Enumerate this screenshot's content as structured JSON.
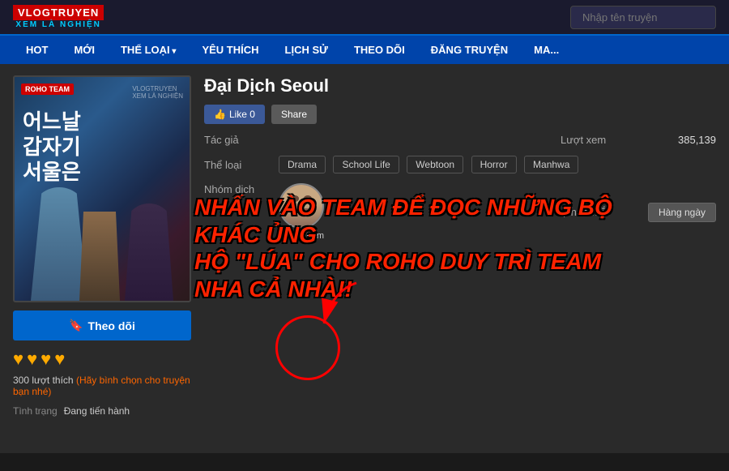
{
  "header": {
    "logo_top": "VLOGTRUYEN",
    "logo_bottom": "XEM LÀ NGHIỆN",
    "search_placeholder": "Nhập tên truyện"
  },
  "nav": {
    "items": [
      {
        "label": "HOT",
        "id": "hot"
      },
      {
        "label": "MỚI",
        "id": "moi"
      },
      {
        "label": "THỂ LOẠI",
        "id": "the-loai",
        "has_arrow": true
      },
      {
        "label": "YÊU THÍCH",
        "id": "yeu-thich"
      },
      {
        "label": "LỊCH SỬ",
        "id": "lich-su"
      },
      {
        "label": "THEO DÕI",
        "id": "theo-doi"
      },
      {
        "label": "ĐĂNG TRUYỆN",
        "id": "dang-truyen"
      },
      {
        "label": "MA...",
        "id": "ma"
      }
    ]
  },
  "manga": {
    "title": "Đại Dịch Seoul",
    "cover_title_korean": "어느날\n갑자기\n서울은",
    "cover_roho_team": "ROHO\nTEAM",
    "like_count": "Like 0",
    "share_label": "Share",
    "tac_gia_label": "Tác giả",
    "tac_gia_value": "",
    "luot_xem_label": "Lượt xem",
    "luot_xem_value": "385,139",
    "the_loai_label": "Thể loại",
    "tags": [
      "Drama",
      "School Life",
      "Webtoon",
      "Horror",
      "Manhwa"
    ],
    "nhom_dich_label": "Nhóm dịch",
    "nhom_dich_team": "Roho Team",
    "lich_ra_mat_label": "Lịch ra mắt",
    "lich_ra_mat_value": "Hàng ngày",
    "theo_doi_label": "Theo dõi",
    "likes_300": "300 lượt thích",
    "vote_text": "(Hãy bình chọn cho truyện bạn nhé)",
    "tinh_trang_label": "Tình trạng",
    "tinh_trang_value": "Đang tiến hành",
    "overlay_line1": "NHẤN VÀO TEAM ĐỂ ĐỌC NHỮNG BỘ KHÁC ỦNG",
    "overlay_line2": "HỘ \"LÚA\" CHO ROHO DUY TRÌ TEAM NHA CẢ NHÀ!!"
  }
}
